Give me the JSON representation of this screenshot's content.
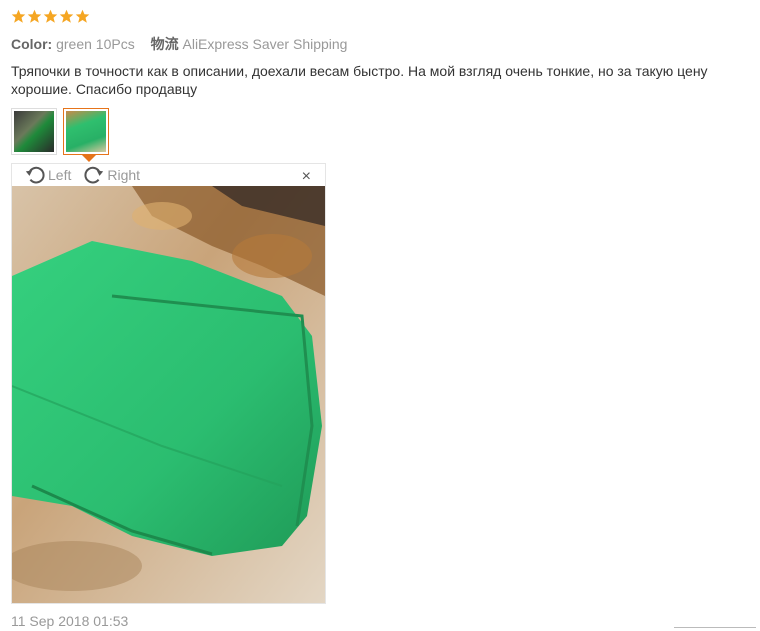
{
  "rating": {
    "stars": 5,
    "color": "#f5a623"
  },
  "meta": {
    "color_label": "Color:",
    "color_value": "green 10Pcs",
    "logistics_label": "物流",
    "logistics_value": "AliExpress Saver Shipping"
  },
  "review": {
    "text": "Тряпочки в точности как в описании, доехали весам быстро. На мой взгляд очень тонкие, но за такую цену хорошие. Спасибо продавцу"
  },
  "thumbnails": [
    {
      "icon": "photo-thumbnail",
      "active": false
    },
    {
      "icon": "photo-thumbnail",
      "active": true
    }
  ],
  "viewer": {
    "rotate_left_label": "Left",
    "rotate_right_label": "Right",
    "close_glyph": "×"
  },
  "date": "11 Sep 2018 01:53",
  "colors": {
    "accent": "#e6741a",
    "towel": "#2fc474"
  }
}
